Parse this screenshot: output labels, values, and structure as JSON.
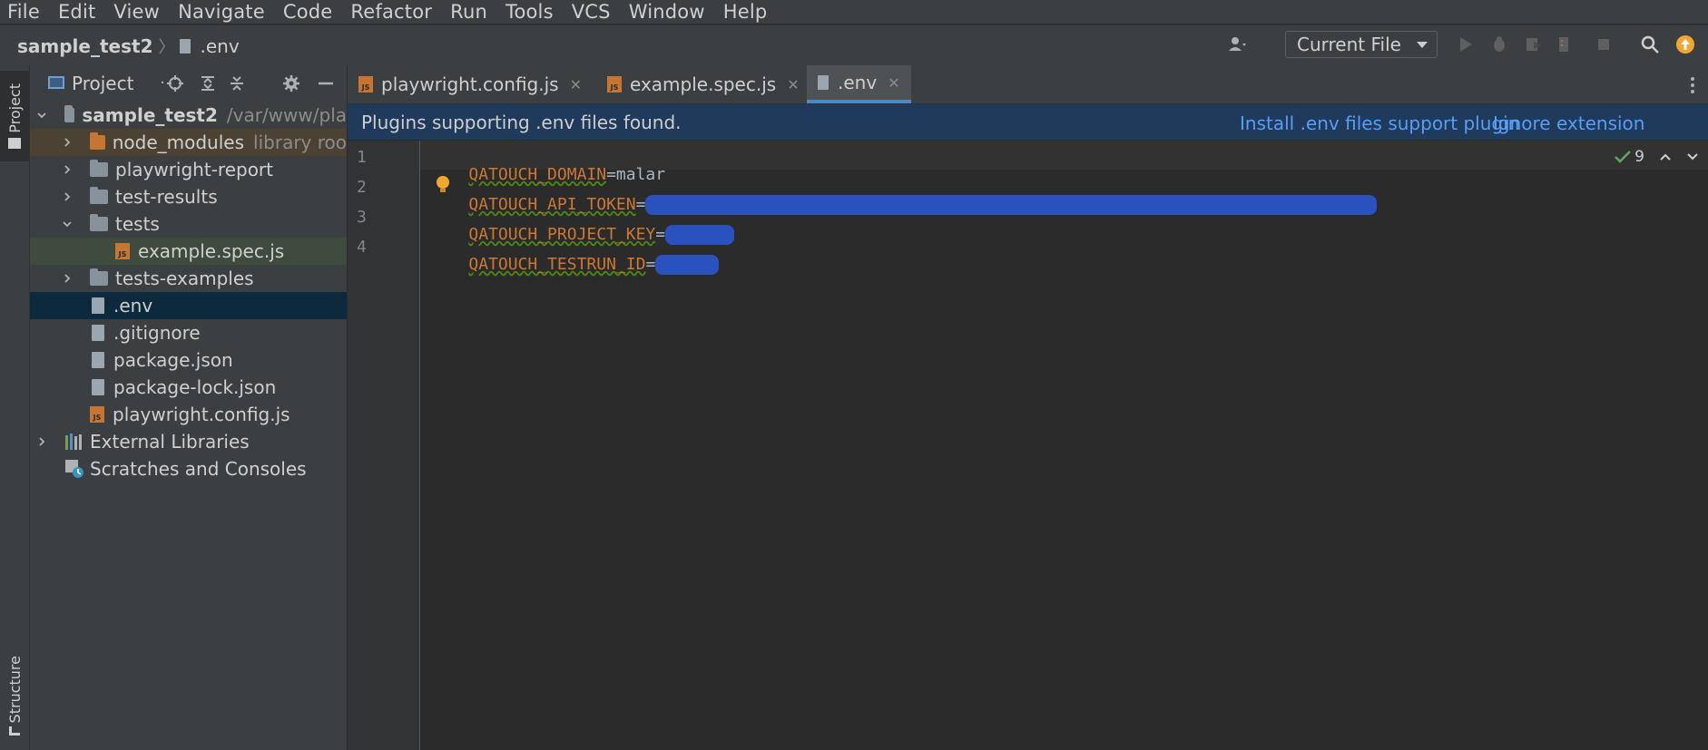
{
  "menu": [
    "File",
    "Edit",
    "View",
    "Navigate",
    "Code",
    "Refactor",
    "Run",
    "Tools",
    "VCS",
    "Window",
    "Help"
  ],
  "breadcrumb": {
    "project": "sample_test2",
    "file": ".env"
  },
  "toolbar": {
    "run_config": "Current File"
  },
  "left_strip": {
    "project_tab": "Project",
    "structure_tab": "Structure"
  },
  "project_panel": {
    "title": "Project",
    "root": {
      "name": "sample_test2",
      "path": "/var/www/pla"
    },
    "items": [
      {
        "label": "node_modules",
        "hint": "library roo"
      },
      {
        "label": "playwright-report"
      },
      {
        "label": "test-results"
      },
      {
        "label": "tests"
      },
      {
        "label": "example.spec.js"
      },
      {
        "label": "tests-examples"
      },
      {
        "label": ".env"
      },
      {
        "label": ".gitignore"
      },
      {
        "label": "package.json"
      },
      {
        "label": "package-lock.json"
      },
      {
        "label": "playwright.config.js"
      },
      {
        "label": "External Libraries"
      },
      {
        "label": "Scratches and Consoles"
      }
    ]
  },
  "tabs": [
    {
      "label": "playwright.config.js"
    },
    {
      "label": "example.spec.js"
    },
    {
      "label": ".env"
    }
  ],
  "notice": {
    "message": "Plugins supporting .env files found.",
    "install": "Install .env files support plugin",
    "ignore": "Ignore extension"
  },
  "editor": {
    "lines": [
      {
        "num": "1",
        "key": "QATOUCH_DOMAIN",
        "eq": "=",
        "value": "malar"
      },
      {
        "num": "2",
        "key": "QATOUCH_API_TOKEN",
        "eq": "=",
        "value": ""
      },
      {
        "num": "3",
        "key": "QATOUCH_PROJECT_KEY",
        "eq": "=",
        "value": ""
      },
      {
        "num": "4",
        "key": "QATOUCH_TESTRUN_ID",
        "eq": "=",
        "value": ""
      }
    ],
    "inspection_count": "9"
  }
}
